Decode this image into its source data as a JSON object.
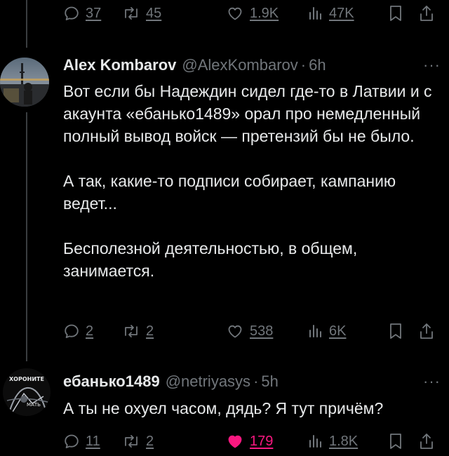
{
  "top_actions": {
    "reply_count": "37",
    "retweet_count": "45",
    "like_count": "1.9K",
    "views_count": "47K"
  },
  "tweet1": {
    "author_name": "Alex Kombarov",
    "author_handle": "@AlexKombarov",
    "separator": "·",
    "time": "6h",
    "more": "···",
    "paragraphs": [
      "Вот если бы Надеждин сидел где-то в Латвии и с акаунта «ебанько1489» орал про немедленный полный вывод войск — претензий бы не было.",
      "А так, какие-то подписи собирает, кампанию ведет...",
      "Бесполезной деятельностью, в общем, занимается."
    ],
    "actions": {
      "reply_count": "2",
      "retweet_count": "2",
      "like_count": "538",
      "views_count": "6K"
    }
  },
  "tweet2": {
    "author_name": "ебанько1489",
    "author_handle": "@netriyasys",
    "separator": "·",
    "time": "5h",
    "more": "···",
    "avatar_text_top": "ХОРОНИТЕ",
    "avatar_text_bottom": "МАТЬ",
    "text": "А ты не охуел часом, дядь? Я тут причём?",
    "actions": {
      "reply_count": "11",
      "retweet_count": "2",
      "like_count": "179",
      "views_count": "1.8K",
      "liked": true
    }
  },
  "colors": {
    "background": "#000000",
    "text": "#e7e9ea",
    "muted": "#71767b",
    "like_active": "#f91880"
  }
}
